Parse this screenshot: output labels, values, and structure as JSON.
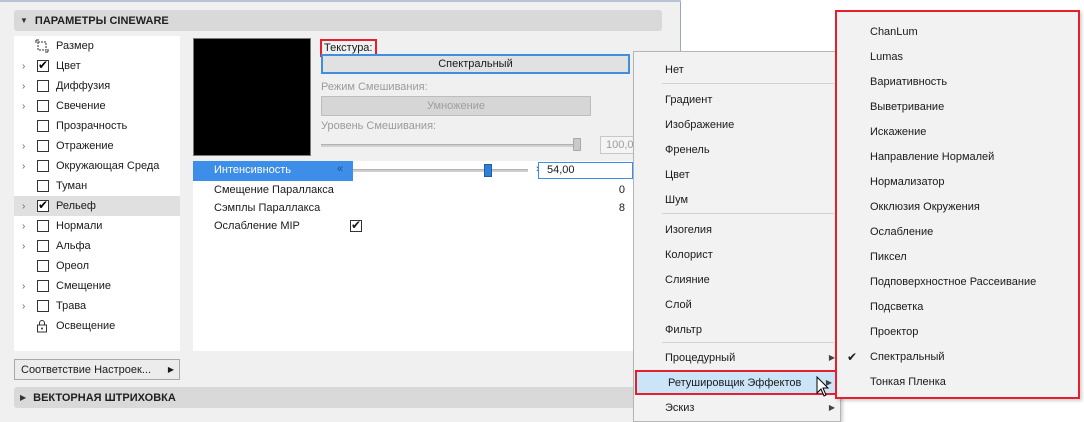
{
  "sections": {
    "cineware_title": "ПАРАМЕТРЫ CINEWARE",
    "vector_title": "ВЕКТОРНАЯ ШТРИХОВКА"
  },
  "channels": [
    {
      "label": "Размер",
      "kind": "icon",
      "icon": "size-icon",
      "arrow": false
    },
    {
      "label": "Цвет",
      "kind": "checkbox",
      "checked": true,
      "arrow": true
    },
    {
      "label": "Диффузия",
      "kind": "checkbox",
      "checked": false,
      "arrow": true
    },
    {
      "label": "Свечение",
      "kind": "checkbox",
      "checked": false,
      "arrow": true
    },
    {
      "label": "Прозрачность",
      "kind": "checkbox",
      "checked": false,
      "arrow": false
    },
    {
      "label": "Отражение",
      "kind": "checkbox",
      "checked": false,
      "arrow": true
    },
    {
      "label": "Окружающая Среда",
      "kind": "checkbox",
      "checked": false,
      "arrow": true
    },
    {
      "label": "Туман",
      "kind": "checkbox",
      "checked": false,
      "arrow": false
    },
    {
      "label": "Рельеф",
      "kind": "checkbox",
      "checked": true,
      "arrow": true,
      "selected": true
    },
    {
      "label": "Нормали",
      "kind": "checkbox",
      "checked": false,
      "arrow": true
    },
    {
      "label": "Альфа",
      "kind": "checkbox",
      "checked": false,
      "arrow": true
    },
    {
      "label": "Ореол",
      "kind": "checkbox",
      "checked": false,
      "arrow": false
    },
    {
      "label": "Смещение",
      "kind": "checkbox",
      "checked": false,
      "arrow": true
    },
    {
      "label": "Трава",
      "kind": "checkbox",
      "checked": false,
      "arrow": true
    },
    {
      "label": "Освещение",
      "kind": "icon",
      "icon": "lock-icon",
      "arrow": false
    }
  ],
  "match_settings_label": "Соответствие Настроек...",
  "texture": {
    "label": "Текстура:",
    "value": "Спектральный",
    "blend_mode_label": "Режим Смешивания:",
    "blend_mode_value": "Умножение",
    "blend_level_label": "Уровень Смешивания:",
    "blend_level_value": "100,0"
  },
  "params": {
    "intensity_label": "Интенсивность",
    "intensity_value": "54,00",
    "intensity_fraction": 0.54,
    "parallax_offset_label": "Смещение Параллакса",
    "parallax_offset_value": "0",
    "parallax_samples_label": "Сэмплы Параллакса",
    "parallax_samples_value": "8",
    "mip_label": "Ослабление MIP",
    "mip_checked": true
  },
  "menu1": {
    "items": [
      "Нет",
      "Градиент",
      "Изображение",
      "Френель",
      "Цвет",
      "Шум",
      "Изогелия",
      "Колорист",
      "Слияние",
      "Слой",
      "Фильтр",
      "Процедурный",
      "Ретушировщик Эффектов",
      "Эскиз"
    ],
    "highlighted": "Ретушировщик Эффектов"
  },
  "menu2": {
    "items": [
      "ChanLum",
      "Lumas",
      "Вариативность",
      "Выветривание",
      "Искажение",
      "Направление Нормалей",
      "Нормализатор",
      "Окклюзия Окружения",
      "Ослабление",
      "Пиксел",
      "Подповерхностное Рассеивание",
      "Подсветка",
      "Проектор",
      "Спектральный",
      "Тонкая Пленка"
    ],
    "checked": "Спектральный"
  },
  "colors": {
    "selection": "#3d8ee8",
    "highlight_frame": "#e4202f",
    "menu_hover": "#cce4f7"
  }
}
